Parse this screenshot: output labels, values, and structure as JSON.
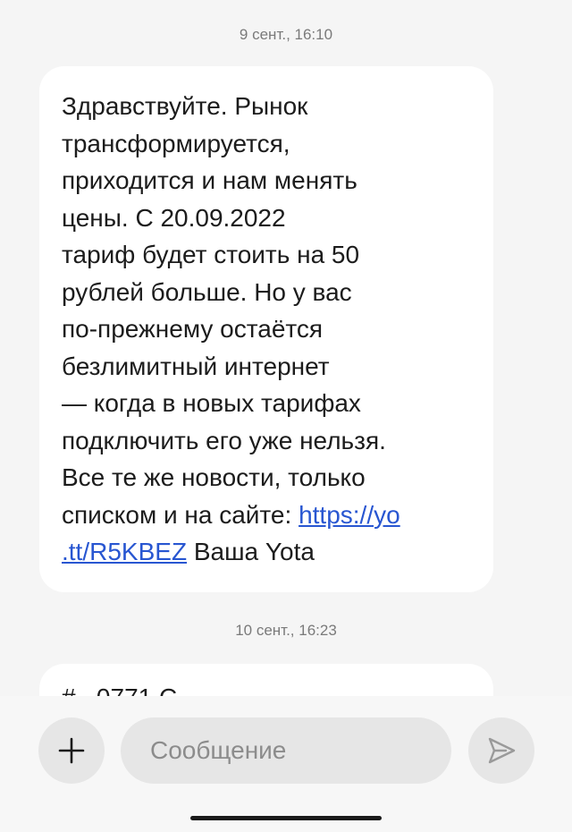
{
  "thread": {
    "messages": [
      {
        "timestamp": "9 сент., 16:10",
        "text_before_link": "Здравствуйте. Рынок\nтрансформируется,\nприходится и нам менять\nцены. С 20.09.2022\nтариф будет стоить на 50\nрублей больше. Но у вас\nпо-прежнему остаётся\nбезлимитный интернет\n— когда в новых тарифах\nподключить его уже нельзя.\nВсе те же новости, только\nсписком и на сайте: ",
        "link_text": "https://yo\n.tt/R5KBEZ",
        "text_after_link": " Ваша Yota"
      },
      {
        "timestamp": "10 сент., 16:23",
        "partial_text": "#_ 0771 C"
      }
    ]
  },
  "composer": {
    "add_icon": "plus-icon",
    "input_placeholder": "Сообщение",
    "input_value": "",
    "send_icon": "send-icon"
  },
  "colors": {
    "background": "#f5f5f5",
    "bubble": "#ffffff",
    "link": "#2856d1",
    "timestamp": "#7a7a7a",
    "composer_button": "#e6e6e6"
  }
}
